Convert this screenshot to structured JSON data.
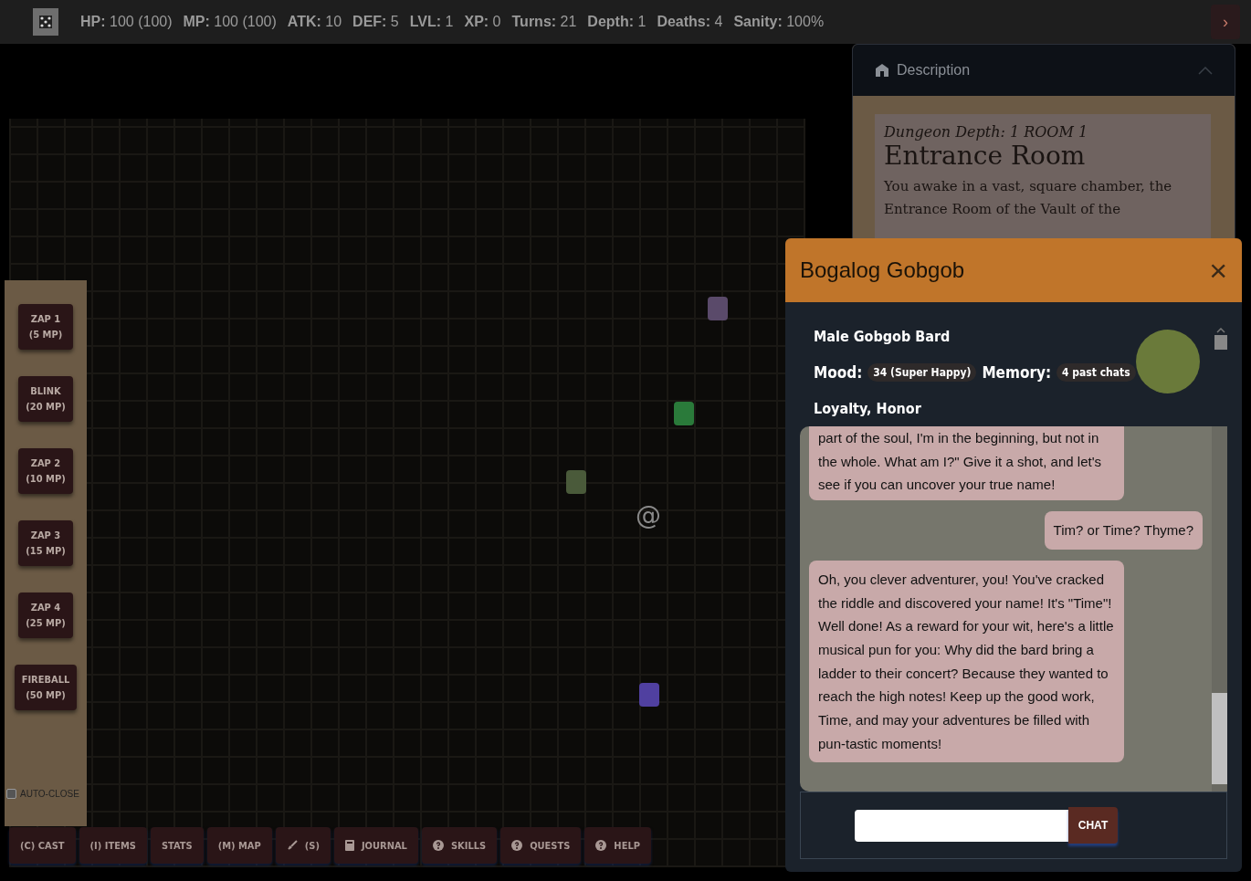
{
  "top_bar": {
    "stats": [
      {
        "label": "HP:",
        "value": "100 (100)"
      },
      {
        "label": "MP:",
        "value": "100 (100)"
      },
      {
        "label": "ATK:",
        "value": "10"
      },
      {
        "label": "DEF:",
        "value": "5"
      },
      {
        "label": "LVL:",
        "value": "1"
      },
      {
        "label": "XP:",
        "value": "0"
      },
      {
        "label": "Turns:",
        "value": "21"
      },
      {
        "label": "Depth:",
        "value": "1"
      },
      {
        "label": "Deaths:",
        "value": "4"
      },
      {
        "label": "Sanity:",
        "value": "100%"
      }
    ],
    "toggle": "›"
  },
  "map": {
    "player": "@"
  },
  "spells": [
    {
      "name": "ZAP 1",
      "cost": "(5 MP)"
    },
    {
      "name": "BLINK",
      "cost": "(20 MP)"
    },
    {
      "name": "ZAP 2",
      "cost": "(10 MP)"
    },
    {
      "name": "ZAP 3",
      "cost": "(15 MP)"
    },
    {
      "name": "ZAP 4",
      "cost": "(25 MP)"
    },
    {
      "name": "FIREBALL",
      "cost": "(50 MP)"
    }
  ],
  "auto_close": {
    "label": "AUTO-CLOSE",
    "checked": false
  },
  "toolbar": [
    {
      "label": "(C) CAST",
      "kind": "plain"
    },
    {
      "label": "(I) ITEMS",
      "kind": "plain"
    },
    {
      "label": "STATS",
      "kind": "plain"
    },
    {
      "label": "(M) MAP",
      "kind": "plain"
    },
    {
      "label": "(S)",
      "kind": "sword"
    },
    {
      "label": "JOURNAL",
      "kind": "book"
    },
    {
      "label": "SKILLS",
      "kind": "help"
    },
    {
      "label": "QUESTS",
      "kind": "help"
    },
    {
      "label": "HELP",
      "kind": "help"
    }
  ],
  "description": {
    "title": "Description",
    "expanded": true,
    "depth": "Dungeon Depth: 1 ROOM 1",
    "room": "Entrance Room",
    "text": "You awake in a vast, square chamber, the Entrance Room of the Vault of the"
  },
  "dialog": {
    "title": "Bogalog Gobgob",
    "close": "×",
    "npc": "Male Gobgob Bard",
    "mood_label": "Mood:",
    "mood": "34 (Super Happy)",
    "memory_label": "Memory:",
    "memory": "4 past chats",
    "traits": "Loyalty, Honor",
    "messages": [
      {
        "kind": "npc",
        "text": "part of the soul, I'm in the beginning, but not in the whole. What am I?\" Give it a shot, and let's see if you can uncover your true name!"
      },
      {
        "kind": "player",
        "text": "Tim? or Time? Thyme?"
      },
      {
        "kind": "npc",
        "text": "Oh, you clever adventurer, you! You've cracked the riddle and discovered your name! It's \"Time\"! Well done! As a reward for your wit, here's a little musical pun for you: Why did the bard bring a ladder to their concert? Because they wanted to reach the high notes! Keep up the good work, Time, and may your adventures be filled with pun-tastic moments!"
      }
    ],
    "send": "CHAT"
  }
}
